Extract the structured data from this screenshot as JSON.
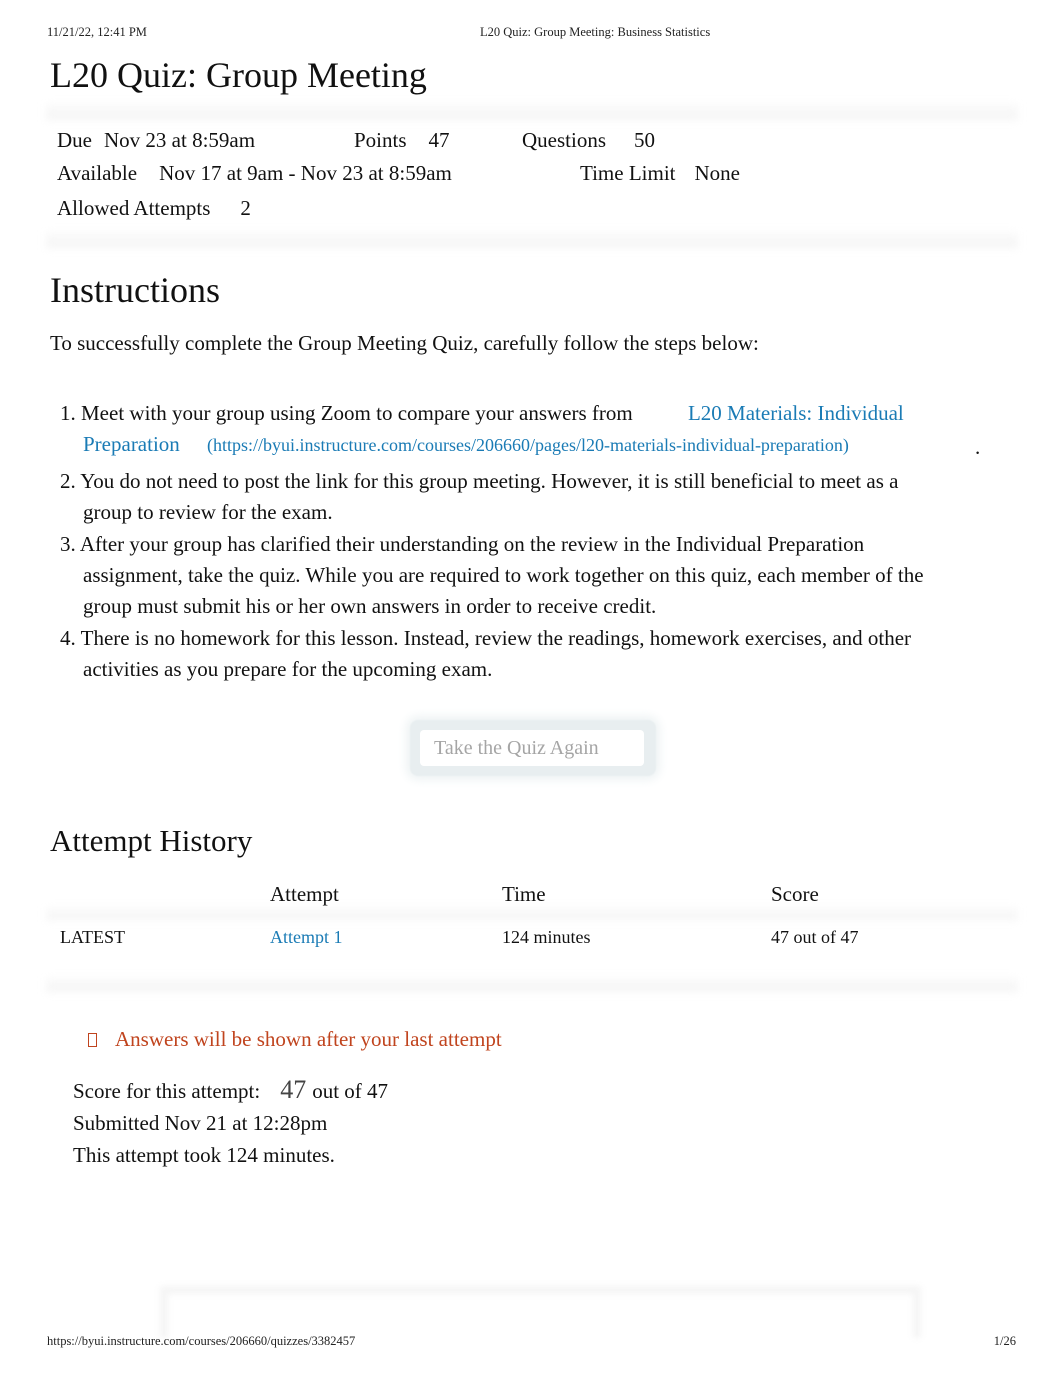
{
  "print_header": {
    "datetime": "11/21/22, 12:41 PM",
    "page_title": "L20 Quiz: Group Meeting: Business Statistics"
  },
  "quiz": {
    "title": "L20 Quiz: Group Meeting",
    "details": {
      "due_label": "Due",
      "due_value": "Nov 23 at 8:59am",
      "points_label": "Points",
      "points_value": "47",
      "questions_label": "Questions",
      "questions_value": "50",
      "available_label": "Available",
      "available_value": "Nov 17 at 9am - Nov 23 at 8:59am",
      "time_limit_label": "Time Limit",
      "time_limit_value": "None",
      "allowed_attempts_label": "Allowed Attempts",
      "allowed_attempts_value": "2"
    }
  },
  "instructions": {
    "heading": "Instructions",
    "intro": "To successfully complete the Group Meeting Quiz, carefully follow the steps below:",
    "steps": [
      {
        "number": "1.",
        "text": "Meet with your group using Zoom to compare your answers from",
        "link_text": "L20 Materials: Individual Preparation",
        "link_url": "(https://byui.instructure.com/courses/206660/pages/l20-materials-individual-preparation)",
        "trailing": "."
      },
      {
        "number": "2.",
        "text": "You do not need to post the link for this group meeting. However, it is still beneficial to meet as a group to review for the exam."
      },
      {
        "number": "3.",
        "text": "After your group has clarified their understanding on the review in the Individual Preparation assignment, take the quiz. While you are required to work together on this quiz, each member of the group must submit his or her own answers in order to receive credit."
      },
      {
        "number": "4.",
        "text": "There is no homework for this lesson. Instead, review the readings, homework exercises, and other activities as you prepare for the upcoming exam."
      }
    ]
  },
  "actions": {
    "retake_label": "Take the Quiz Again"
  },
  "attempt_history": {
    "heading": "Attempt History",
    "columns": [
      "",
      "Attempt",
      "Time",
      "Score"
    ],
    "rows": [
      {
        "tag": "LATEST",
        "attempt": "Attempt 1",
        "time": "124 minutes",
        "score": "47 out of 47"
      }
    ]
  },
  "result": {
    "notice": "Answers will be shown after your last attempt",
    "notice_icon": "info-icon",
    "score_label": "Score for this attempt:",
    "score_value": "47",
    "score_suffix": "out of 47",
    "submitted": "Submitted Nov 21 at 12:28pm",
    "duration": "This attempt took 124 minutes."
  },
  "print_footer": {
    "url": "https://byui.instructure.com/courses/206660/quizzes/3382457",
    "page": "1/26"
  },
  "colors": {
    "link": "#1a7bb5",
    "notice": "#c0441e"
  }
}
